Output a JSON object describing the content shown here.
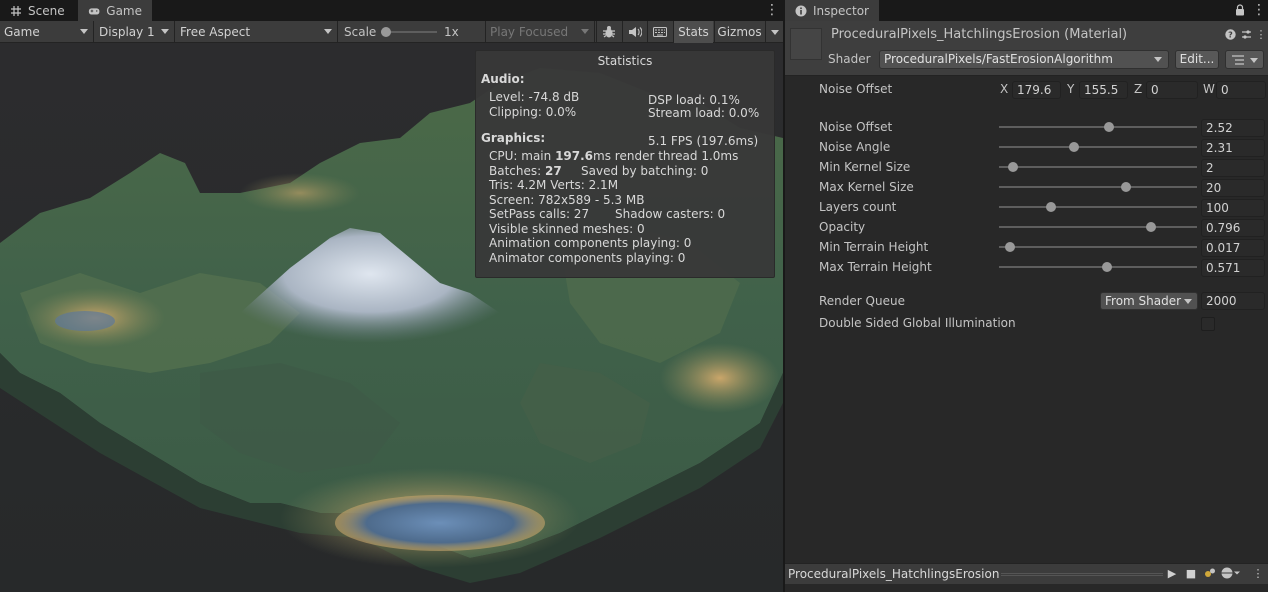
{
  "game_panel": {
    "tabs": [
      {
        "label": "Scene",
        "icon": "grid-icon"
      },
      {
        "label": "Game",
        "icon": "gamepad-icon"
      }
    ],
    "toolbar": {
      "view_select": "Game",
      "display_select": "Display 1",
      "aspect_select": "Free Aspect",
      "scale_label": "Scale",
      "scale_value": "1x",
      "scale_fraction": 0.0,
      "play_mode_select": "Play Focused",
      "stats_label": "Stats",
      "gizmos_label": "Gizmos"
    },
    "statistics": {
      "title": "Statistics",
      "audio_heading": "Audio:",
      "audio_level": "Level: -74.8 dB",
      "audio_clipping": "Clipping: 0.0%",
      "dsp_load": "DSP load: 0.1%",
      "stream_load": "Stream load: 0.0%",
      "graphics_heading": "Graphics:",
      "fps": "5.1 FPS (197.6ms)",
      "cpu_prefix": "CPU: main ",
      "cpu_main": "197.6",
      "cpu_suffix": "ms  render thread 1.0ms",
      "batches_prefix": "Batches: ",
      "batches_value": "27",
      "saved_by_batching": "Saved by batching: 0",
      "tris_verts": "Tris: 4.2M  Verts: 2.1M",
      "screen": "Screen: 782x589 - 5.3 MB",
      "setpass": "SetPass calls: 27",
      "shadow_casters": "Shadow casters: 0",
      "skinned_meshes": "Visible skinned meshes: 0",
      "animation_components": "Animation components playing: 0",
      "animator_components": "Animator components playing: 0"
    }
  },
  "inspector": {
    "tab_label": "Inspector",
    "tab_icon": "info-icon",
    "material_name": "ProceduralPixels_HatchlingsErosion (Material)",
    "shader_label": "Shader",
    "shader_value": "ProceduralPixels/FastErosionAlgorithm",
    "edit_label": "Edit...",
    "vector_property": {
      "label": "Noise Offset",
      "x": "179.6",
      "y": "155.5",
      "z": "0",
      "w": "0"
    },
    "vector_axis_labels": {
      "x": "X",
      "y": "Y",
      "z": "Z",
      "w": "W"
    },
    "sliders": [
      {
        "label": "Noise Offset",
        "value": "2.52",
        "fraction": 0.56
      },
      {
        "label": "Noise Angle",
        "value": "2.31",
        "fraction": 0.37
      },
      {
        "label": "Min Kernel Size",
        "value": "2",
        "fraction": 0.05
      },
      {
        "label": "Max Kernel Size",
        "value": "20",
        "fraction": 0.65
      },
      {
        "label": "Layers count",
        "value": "100",
        "fraction": 0.25
      },
      {
        "label": "Opacity",
        "value": "0.796",
        "fraction": 0.78
      },
      {
        "label": "Min Terrain Height",
        "value": "0.017",
        "fraction": 0.03
      },
      {
        "label": "Max Terrain Height",
        "value": "0.571",
        "fraction": 0.55
      }
    ],
    "render_queue_label": "Render Queue",
    "render_queue_mode": "From Shader",
    "render_queue_value": "2000",
    "double_sided_gi_label": "Double Sided Global Illumination",
    "double_sided_gi_checked": false,
    "preview_name": "ProceduralPixels_HatchlingsErosion"
  }
}
